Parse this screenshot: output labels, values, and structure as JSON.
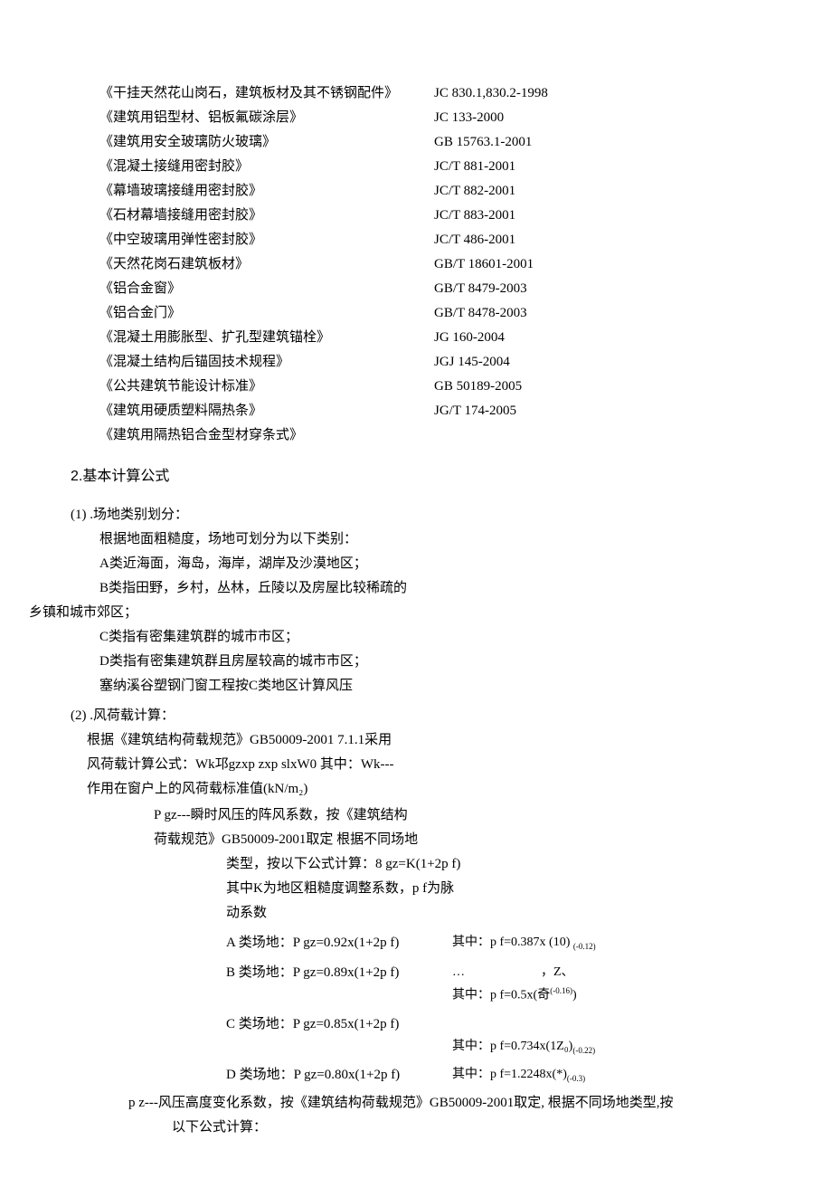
{
  "standards": [
    {
      "name": "《干挂天然花山岗石，建筑板材及其不锈钢配件》",
      "code": "JC 830.1,830.2-1998"
    },
    {
      "name": "《建筑用铝型材、铝板氟碳涂层》",
      "code": "JC 133-2000"
    },
    {
      "name": "《建筑用安全玻璃防火玻璃》",
      "code": "GB 15763.1-2001"
    },
    {
      "name": "《混凝土接缝用密封胶》",
      "code": "JC/T 881-2001"
    },
    {
      "name": "《幕墙玻璃接缝用密封胶》",
      "code": "JC/T 882-2001"
    },
    {
      "name": "《石材幕墙接缝用密封胶》",
      "code": "JC/T 883-2001"
    },
    {
      "name": "《中空玻璃用弹性密封胶》",
      "code": "JC/T 486-2001"
    },
    {
      "name": "《天然花岗石建筑板材》",
      "code": "GB/T 18601-2001"
    },
    {
      "name": "《铝合金窗》",
      "code": "GB/T 8479-2003"
    },
    {
      "name": "《铝合金门》",
      "code": "GB/T 8478-2003"
    },
    {
      "name": "《混凝土用膨胀型、扩孔型建筑锚栓》",
      "code": "JG 160-2004"
    },
    {
      "name": "《混凝土结构后锚固技术规程》",
      "code": "JGJ 145-2004"
    },
    {
      "name": "《公共建筑节能设计标准》",
      "code": "GB 50189-2005"
    },
    {
      "name": "《建筑用硬质塑料隔热条》",
      "code": "JG/T 174-2005"
    },
    {
      "name": "《建筑用隔热铝合金型材穿条式》",
      "code": ""
    }
  ],
  "section2_title": "2.基本计算公式",
  "item1": {
    "heading": "(1) .场地类别划分：",
    "lines": [
      "根据地面粗糙度，场地可划分为以下类别：",
      "A类近海面，海岛，海岸，湖岸及沙漠地区；",
      "B类指田野，乡村，丛林，丘陵以及房屋比较稀疏的",
      "乡镇和城市郊区；",
      "C类指有密集建筑群的城市市区；",
      "D类指有密集建筑群且房屋较高的城市市区；",
      "塞纳溪谷塑钢门窗工程按C类地区计算风压"
    ]
  },
  "item2": {
    "heading": "(2) .风荷载计算：",
    "para1": "根据《建筑结构荷载规范》GB50009-2001 7.1.1采用",
    "para2": "风荷载计算公式：Wk邛gzxp zxp slxW0 其中：Wk---",
    "para3": "作用在窗户上的风荷载标准值(kN/m₂)",
    "pgz_intro1": "P gz---瞬时风压的阵风系数，按《建筑结构",
    "pgz_intro2": "荷载规范》GB50009-2001取定 根据不同场地",
    "pgz_intro3": "类型，按以下公式计算：8 gz=K(1+2p f)",
    "pgz_intro4": "其中K为地区粗糙度调整系数，p f为脉",
    "pgz_intro5": "动系数",
    "rows": [
      {
        "left": "A 类场地：P gz=0.92x(1+2p f)",
        "right": "其中：p f=0.387x (10)",
        "sub": "(-0.12)"
      },
      {
        "left": "B 类场地：P gz=0.89x(1+2p f)",
        "right": "…　　　　　　，Z、",
        "right2": "其中：p f=0.5x(奇",
        "sub2": "(-0.16)"
      },
      {
        "left": "C 类场地：P gz=0.85x(1+2p f)",
        "right": "其中：p f=0.734x(1Z₀)",
        "sub": "(-0.22)"
      },
      {
        "left": "D 类场地：P gz=0.80x(1+2p f)",
        "right": "其中：p f=1.2248x(*)",
        "sub": "(-0.3)"
      }
    ],
    "pz1": "p z---风压高度变化系数，按《建筑结构荷载规范》GB50009-2001取定, 根据不同场地类型,按",
    "pz2": "以下公式计算："
  }
}
